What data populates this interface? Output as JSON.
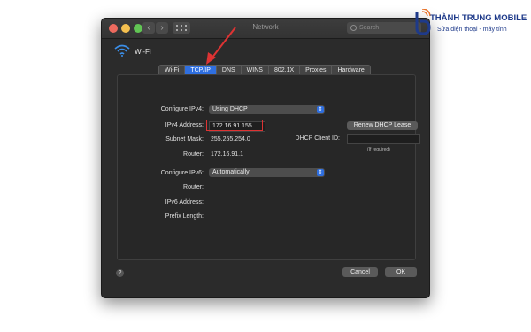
{
  "window": {
    "title": "Network",
    "search_placeholder": "Search"
  },
  "service": {
    "name": "Wi-Fi",
    "icon": "wifi-icon"
  },
  "tabs": [
    {
      "label": "Wi-Fi",
      "active": false
    },
    {
      "label": "TCP/IP",
      "active": true
    },
    {
      "label": "DNS",
      "active": false
    },
    {
      "label": "WINS",
      "active": false
    },
    {
      "label": "802.1X",
      "active": false
    },
    {
      "label": "Proxies",
      "active": false
    },
    {
      "label": "Hardware",
      "active": false
    }
  ],
  "ipv4": {
    "configure_label": "Configure IPv4:",
    "configure_value": "Using DHCP",
    "address_label": "IPv4 Address:",
    "address_value": "172.16.91.155",
    "subnet_label": "Subnet Mask:",
    "subnet_value": "255.255.254.0",
    "router_label": "Router:",
    "router_value": "172.16.91.1",
    "renew_button": "Renew DHCP Lease",
    "client_id_label": "DHCP Client ID:",
    "client_id_value": "",
    "client_id_hint": "(If required)"
  },
  "ipv6": {
    "configure_label": "Configure IPv6:",
    "configure_value": "Automatically",
    "router_label": "Router:",
    "address_label": "IPv6 Address:",
    "prefix_label": "Prefix Length:"
  },
  "footer": {
    "help": "?",
    "cancel": "Cancel",
    "ok": "OK"
  },
  "watermark": {
    "brand": "THÀNH TRUNG MOBILE",
    "tagline": "Sửa điện thoại - máy tính"
  },
  "colors": {
    "accent": "#2f6fe0",
    "highlight": "#dd3333",
    "brand": "#1e3a8a",
    "brand_orange": "#e8732a"
  }
}
